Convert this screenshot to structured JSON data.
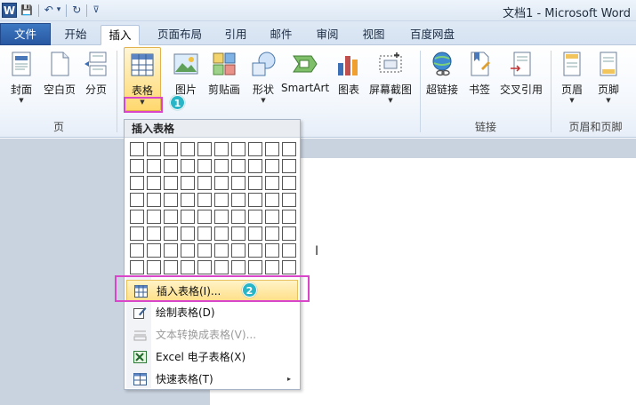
{
  "window": {
    "title": "文档1 - Microsoft Word"
  },
  "qat": {
    "word_logo": "W",
    "save": "💾",
    "undo": "↶",
    "undo_arrow": "▾",
    "redo": "↻",
    "customize": "⊽"
  },
  "tabs": [
    {
      "label": "文件"
    },
    {
      "label": "开始"
    },
    {
      "label": "插入"
    },
    {
      "label": "页面布局"
    },
    {
      "label": "引用"
    },
    {
      "label": "邮件"
    },
    {
      "label": "审阅"
    },
    {
      "label": "视图"
    },
    {
      "label": "百度网盘"
    }
  ],
  "ribbon": {
    "buttons": [
      {
        "label": "封面",
        "icon": "cover-page-icon"
      },
      {
        "label": "空白页",
        "icon": "blank-page-icon"
      },
      {
        "label": "分页",
        "icon": "page-break-icon"
      },
      {
        "label": "表格",
        "icon": "table-icon"
      },
      {
        "label": "图片",
        "icon": "picture-icon"
      },
      {
        "label": "剪贴画",
        "icon": "clip-art-icon"
      },
      {
        "label": "形状",
        "icon": "shapes-icon"
      },
      {
        "label": "SmartArt",
        "icon": "smartart-icon"
      },
      {
        "label": "图表",
        "icon": "chart-icon"
      },
      {
        "label": "屏幕截图",
        "icon": "screenshot-icon"
      },
      {
        "label": "超链接",
        "icon": "hyperlink-icon"
      },
      {
        "label": "书签",
        "icon": "bookmark-icon"
      },
      {
        "label": "交叉引用",
        "icon": "cross-reference-icon"
      },
      {
        "label": "页眉",
        "icon": "header-icon"
      },
      {
        "label": "页脚",
        "icon": "footer-icon"
      }
    ],
    "groups": [
      "页",
      "链接",
      "页眉和页脚"
    ],
    "dropdown_arrow": "▼"
  },
  "annotations": {
    "step1": "1",
    "step2": "2"
  },
  "dropdown": {
    "title": "插入表格",
    "grid_cols": 10,
    "grid_rows": 8,
    "items": [
      {
        "label": "插入表格(I)...",
        "icon": "insert-table-icon",
        "state": "hover"
      },
      {
        "label": "绘制表格(D)",
        "icon": "draw-table-icon",
        "state": "normal"
      },
      {
        "label": "文本转换成表格(V)...",
        "icon": "text-to-table-icon",
        "state": "disabled"
      },
      {
        "label": "Excel 电子表格(X)",
        "icon": "excel-icon",
        "state": "normal"
      },
      {
        "label": "快速表格(T)",
        "icon": "quick-tables-icon",
        "state": "normal",
        "submenu": "▸"
      }
    ]
  },
  "document": {
    "cursor": "Ι"
  }
}
